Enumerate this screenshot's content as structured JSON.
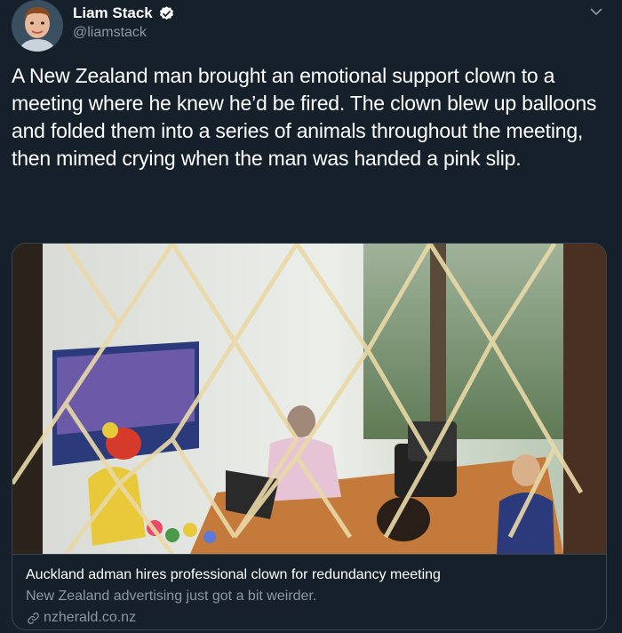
{
  "author": {
    "display_name": "Liam Stack",
    "handle": "@liamstack",
    "verified_icon": "verified-badge-icon",
    "avatar": "user-avatar"
  },
  "menu_icon": "chevron-down-icon",
  "tweet": {
    "text": "A New Zealand man brought an emotional support clown to a meeting where he knew he’d be fired. The clown blew up balloons and folded them into a series of animals throughout the meeting, then mimed crying when the man was handed a pink slip."
  },
  "card": {
    "image": "office-meeting-photo",
    "title": "Auckland adman hires professional clown for redundancy meeting",
    "description": "New Zealand advertising just got a bit weirder.",
    "domain": "nzherald.co.nz",
    "link_icon": "link-icon"
  },
  "colors": {
    "background": "#15202b",
    "text": "#ffffff",
    "secondary_text": "#8899a6",
    "border": "#38444d",
    "verified": "#ffffff"
  }
}
